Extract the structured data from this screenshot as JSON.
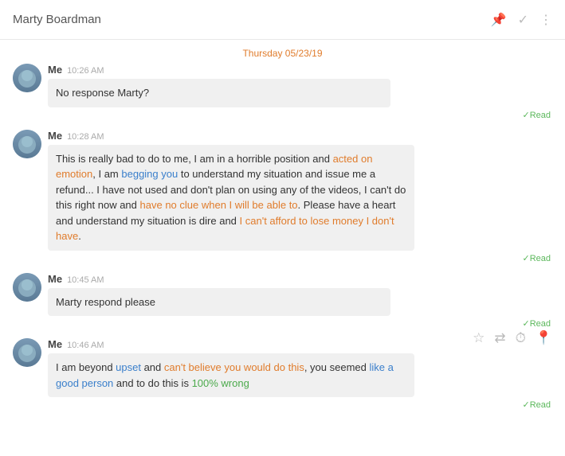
{
  "header": {
    "title": "Marty Boardman",
    "icons": [
      "pin-icon",
      "check-icon",
      "more-icon"
    ]
  },
  "date_separator": "Thursday 05/23/19",
  "messages": [
    {
      "id": "msg1",
      "sender": "Me",
      "time": "10:26 AM",
      "bubble": "No response Marty?",
      "read_label": "✓Read",
      "bubble_type": "short"
    },
    {
      "id": "msg2",
      "sender": "Me",
      "time": "10:28 AM",
      "bubble_segments": [
        {
          "text": "This is really bad to do to me, I am in a horrible position and ",
          "color": "normal"
        },
        {
          "text": "acted on emotion",
          "color": "orange"
        },
        {
          "text": ", I am ",
          "color": "normal"
        },
        {
          "text": "begging you",
          "color": "blue"
        },
        {
          "text": " to understand my situation and issue me a refund... I have not used and don't plan on using any of the videos, I can't do this right now and ",
          "color": "normal"
        },
        {
          "text": "have no clue when I will be able to",
          "color": "orange"
        },
        {
          "text": ". Please have a heart and understand my situation is dire and ",
          "color": "normal"
        },
        {
          "text": "I can't afford to lose money I don't have",
          "color": "orange"
        },
        {
          "text": ".",
          "color": "normal"
        }
      ],
      "read_label": "✓Read",
      "bubble_type": "long"
    },
    {
      "id": "msg3",
      "sender": "Me",
      "time": "10:45 AM",
      "bubble": "Marty respond please",
      "read_label": "✓Read",
      "bubble_type": "short"
    },
    {
      "id": "msg4",
      "sender": "Me",
      "time": "10:46 AM",
      "bubble_segments": [
        {
          "text": "I am beyond ",
          "color": "normal"
        },
        {
          "text": "upset",
          "color": "blue"
        },
        {
          "text": " and ",
          "color": "normal"
        },
        {
          "text": "can't believe you would do this",
          "color": "orange"
        },
        {
          "text": ", you seemed ",
          "color": "normal"
        },
        {
          "text": "like a good person",
          "color": "blue"
        },
        {
          "text": " and to do this is ",
          "color": "normal"
        },
        {
          "text": "100% wrong",
          "color": "green"
        }
      ],
      "read_label": "✓Read",
      "bubble_type": "medium"
    }
  ],
  "action_bar": {
    "icons": [
      {
        "name": "star-icon",
        "symbol": "★"
      },
      {
        "name": "forward-icon",
        "symbol": "⇄"
      },
      {
        "name": "history-icon",
        "symbol": "⏱"
      },
      {
        "name": "location-icon",
        "symbol": "📍"
      }
    ]
  }
}
